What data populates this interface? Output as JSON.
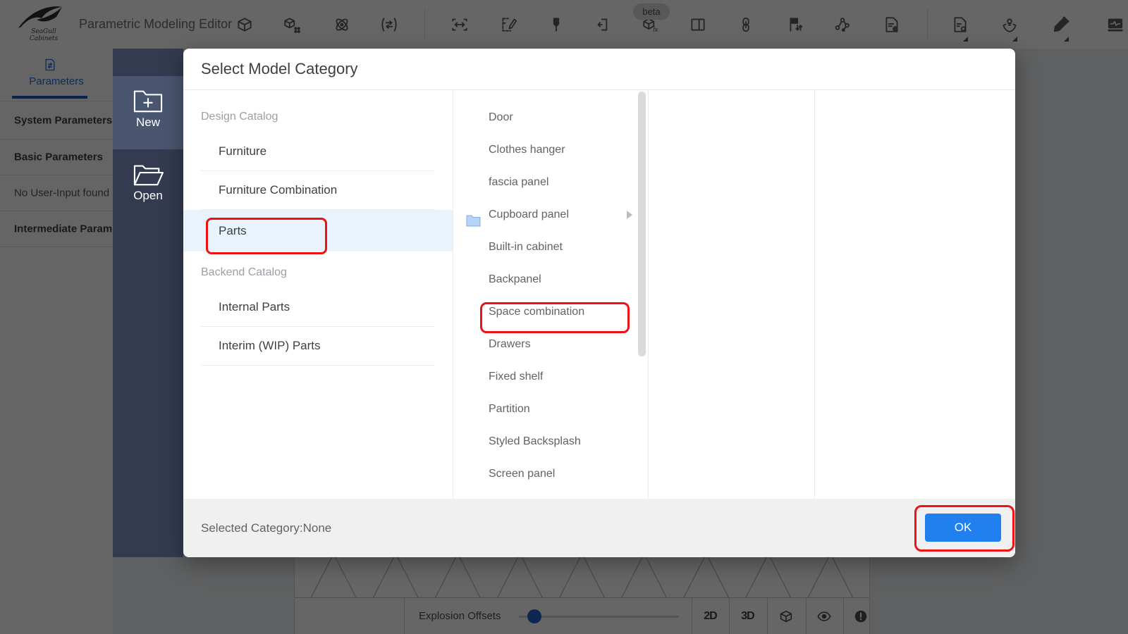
{
  "topbar": {
    "brand_line1": "SeaGull",
    "brand_line2": "Cabinets",
    "title": "Parametric Modeling Editor",
    "beta": "beta",
    "fx_label": "fx",
    "tool_icons": [
      "box-3d-icon",
      "cube-grid-icon",
      "atom-icon",
      "swap-arrows-icon",
      "resize-width-icon",
      "edit-box-icon",
      "pin-icon",
      "bracket-swap-icon",
      "cube-fx-icon",
      "split-panel-icon",
      "link-icon",
      "clamp-arrows-icon",
      "node-graph-icon",
      "file-gear-icon",
      "file-settings-icon",
      "shield-lamp-icon",
      "pencil-icon",
      "monitor-pulse-icon"
    ]
  },
  "sidebar": {
    "tab_label": "Parameters",
    "rows": [
      "System Parameters",
      "Basic Parameters",
      "No User-Input found",
      "Intermediate Param"
    ]
  },
  "launcher": {
    "new_label": "New",
    "open_label": "Open"
  },
  "modal": {
    "title": "Select Model Category",
    "groups": [
      {
        "header": "Design Catalog",
        "items": [
          "Furniture",
          "Furniture Combination",
          "Parts"
        ]
      },
      {
        "header": "Backend Catalog",
        "items": [
          "Internal Parts",
          "Interim (WIP) Parts"
        ]
      }
    ],
    "selected_item": "Parts",
    "subcategories": [
      "Door",
      "Clothes hanger",
      "fascia panel",
      "Cupboard panel",
      "Built-in cabinet",
      "Backpanel",
      "Space combination",
      "Drawers",
      "Fixed shelf",
      "Partition",
      "Styled Backsplash",
      "Screen panel"
    ],
    "expandable_subcategory": "Cupboard panel",
    "footer_status": "Selected Category:None",
    "ok_label": "OK"
  },
  "canvas_toolbar": {
    "slider_label": "Explosion Offsets",
    "buttons": [
      "2D",
      "3D"
    ],
    "icons": [
      "cube-view-icon",
      "eye-icon",
      "warning-icon"
    ]
  },
  "colors": {
    "accent_blue": "#1a73e8",
    "ok_button_blue": "#2080f0",
    "annotation_red": "#ee1212",
    "launcher_navy": "#343b50",
    "launcher_selected": "#4a5670",
    "selected_row_blue": "#e9f3fd"
  }
}
